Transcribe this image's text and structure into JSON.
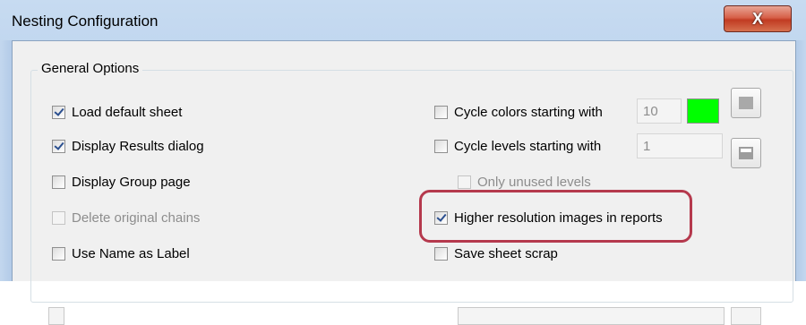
{
  "window": {
    "title": "Nesting Configuration",
    "close_label": "X"
  },
  "group": {
    "title": "General Options"
  },
  "left_options": [
    {
      "label": "Load default sheet",
      "checked": true,
      "enabled": true
    },
    {
      "label": "Display Results dialog",
      "checked": true,
      "enabled": true
    },
    {
      "label": "Display Group page",
      "checked": false,
      "enabled": true
    },
    {
      "label": "Delete original chains",
      "checked": false,
      "enabled": false
    },
    {
      "label": "Use Name as Label",
      "checked": false,
      "enabled": true
    }
  ],
  "right_options": {
    "cycle_colors": {
      "label": "Cycle colors starting with",
      "checked": false,
      "value": "10",
      "swatch_color": "#00ff00"
    },
    "cycle_levels": {
      "label": "Cycle levels starting with",
      "checked": false,
      "value": "1"
    },
    "only_unused_levels": {
      "label": "Only unused levels",
      "checked": false,
      "enabled": false
    },
    "higher_resolution": {
      "label": "Higher resolution images in reports",
      "checked": true
    },
    "save_sheet_scrap": {
      "label": "Save sheet scrap",
      "checked": false
    }
  },
  "colors": {
    "highlight": "#b5394d"
  }
}
